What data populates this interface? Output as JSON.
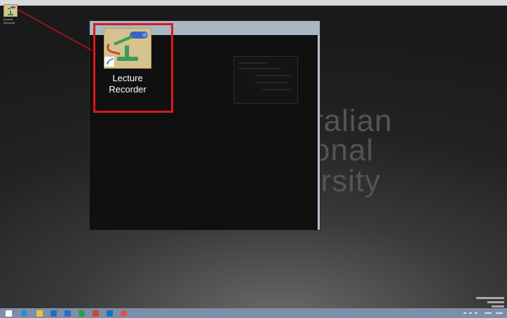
{
  "desktop": {
    "shortcut_small": {
      "label": "Lecture Recorder",
      "icon": "lecture-recorder-icon"
    },
    "background_words": [
      "ralian",
      "onal",
      "ersity"
    ]
  },
  "magnified": {
    "shortcut": {
      "label_line1": "Lecture",
      "label_line2": "Recorder",
      "icon": "lecture-recorder-icon"
    }
  },
  "colors": {
    "highlight": "#e0161a",
    "arrow": "#b0111a",
    "taskbar": "#7d8ea8"
  },
  "taskbar": {
    "buttons": [
      {
        "name": "start-button",
        "icon": "windows-logo-icon",
        "color": "#ffffff"
      },
      {
        "name": "taskbar-ie",
        "icon": "internet-explorer-icon",
        "color": "#2a8ad6"
      },
      {
        "name": "taskbar-explorer",
        "icon": "folder-icon",
        "color": "#e6c53d"
      },
      {
        "name": "taskbar-outlook",
        "icon": "outlook-icon",
        "color": "#1f6ec4"
      },
      {
        "name": "taskbar-word",
        "icon": "word-icon",
        "color": "#2c6fc7"
      },
      {
        "name": "taskbar-excel",
        "icon": "excel-icon",
        "color": "#2e9e4a"
      },
      {
        "name": "taskbar-powerpoint",
        "icon": "powerpoint-icon",
        "color": "#d24726"
      },
      {
        "name": "taskbar-app",
        "icon": "app-icon",
        "color": "#1b6fb9"
      },
      {
        "name": "taskbar-chrome",
        "icon": "chrome-icon",
        "color": "#e94b3c"
      }
    ]
  }
}
